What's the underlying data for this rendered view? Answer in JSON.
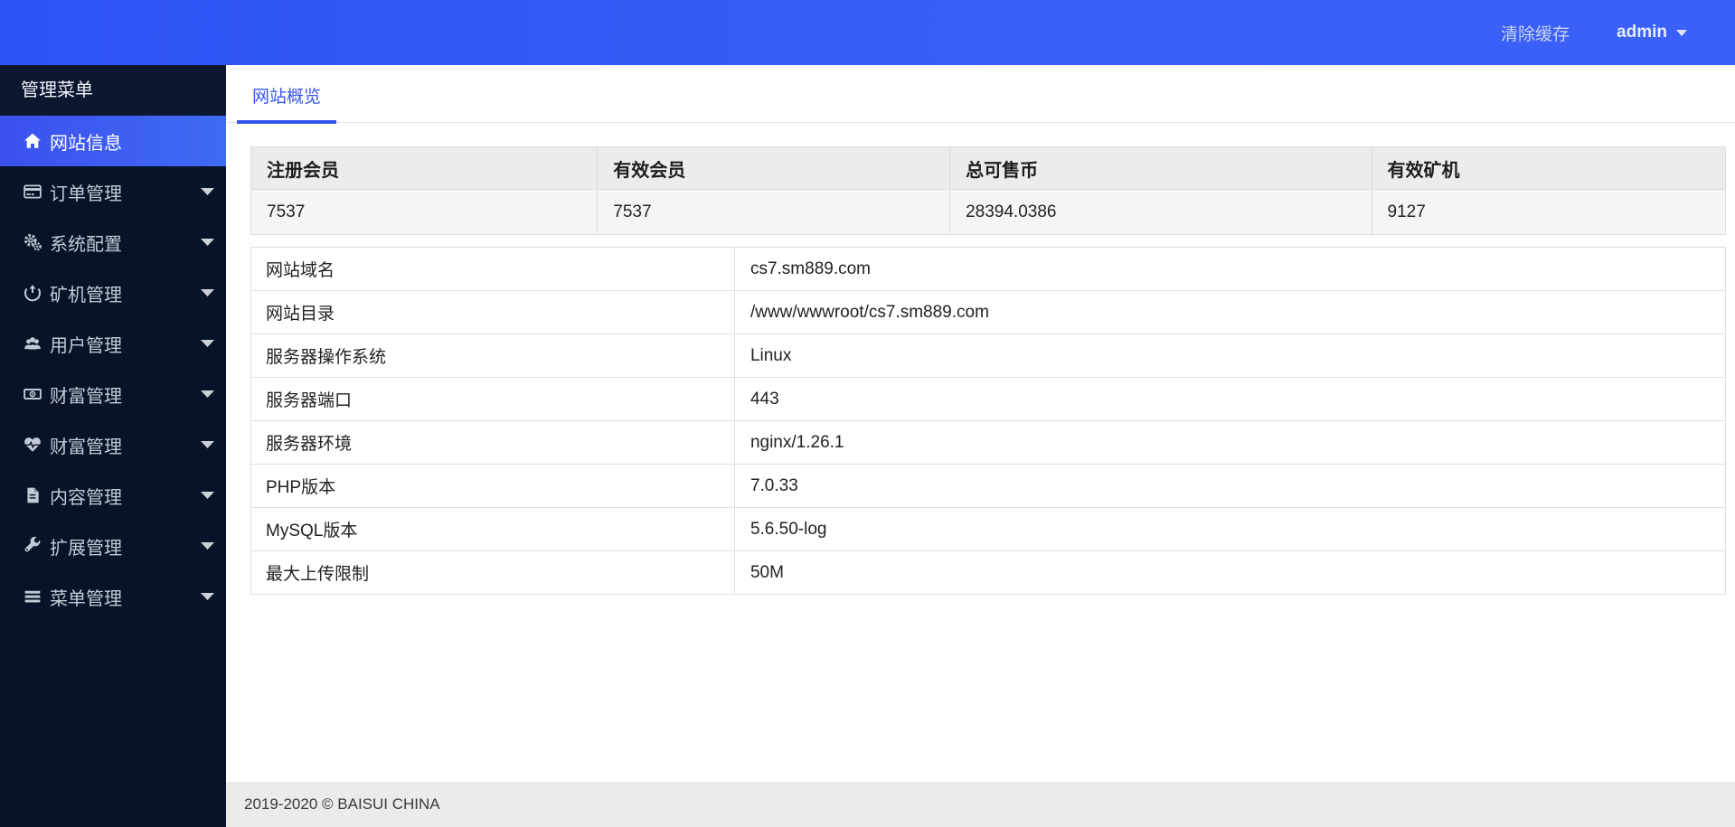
{
  "topbar": {
    "clear_cache_label": "清除缓存",
    "username": "admin"
  },
  "sidebar": {
    "header": "管理菜单",
    "items": [
      {
        "label": "网站信息",
        "icon": "home-icon",
        "active": true,
        "has_children": false
      },
      {
        "label": "订单管理",
        "icon": "credit-card-icon",
        "active": false,
        "has_children": true
      },
      {
        "label": "系统配置",
        "icon": "gears-icon",
        "active": false,
        "has_children": true
      },
      {
        "label": "矿机管理",
        "icon": "miner-icon",
        "active": false,
        "has_children": true
      },
      {
        "label": "用户管理",
        "icon": "users-icon",
        "active": false,
        "has_children": true
      },
      {
        "label": "财富管理",
        "icon": "money-icon",
        "active": false,
        "has_children": true
      },
      {
        "label": "财富管理",
        "icon": "heartbeat-icon",
        "active": false,
        "has_children": true
      },
      {
        "label": "内容管理",
        "icon": "file-text-icon",
        "active": false,
        "has_children": true
      },
      {
        "label": "扩展管理",
        "icon": "wrench-icon",
        "active": false,
        "has_children": true
      },
      {
        "label": "菜单管理",
        "icon": "bars-icon",
        "active": false,
        "has_children": true
      }
    ]
  },
  "main": {
    "tab": "网站概览",
    "stats": {
      "columns": [
        "注册会员",
        "有效会员",
        "总可售币",
        "有效矿机"
      ],
      "values": [
        "7537",
        "7537",
        "28394.0386",
        "9127"
      ]
    },
    "info": {
      "rows": [
        {
          "label": "网站域名",
          "value": "cs7.sm889.com"
        },
        {
          "label": "网站目录",
          "value": "/www/wwwroot/cs7.sm889.com"
        },
        {
          "label": "服务器操作系统",
          "value": "Linux"
        },
        {
          "label": "服务器端口",
          "value": "443"
        },
        {
          "label": "服务器环境",
          "value": "nginx/1.26.1"
        },
        {
          "label": "PHP版本",
          "value": "7.0.33"
        },
        {
          "label": "MySQL版本",
          "value": "5.6.50-log"
        },
        {
          "label": "最大上传限制",
          "value": "50M"
        }
      ]
    }
  },
  "footer": {
    "copyright": "2019-2020 © BAISUI CHINA"
  },
  "colors": {
    "topbar_blue": "#3355f7",
    "active_item_blue": "#3d5df1",
    "sidebar_bg": "#071427",
    "sidebar_header_bg": "#0d1830",
    "tab_accent": "#2f54eb",
    "stats_header_bg": "#ececec",
    "stats_value_bg": "#f5f5f5",
    "footer_bg": "#ebebeb"
  }
}
